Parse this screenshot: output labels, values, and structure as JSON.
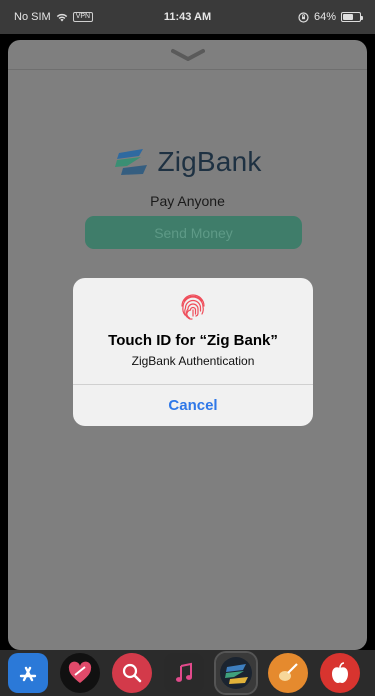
{
  "status_bar": {
    "carrier": "No SIM",
    "vpn": "VPN",
    "time": "11:43 AM",
    "battery_percent": "64%",
    "battery_level": 0.64
  },
  "app": {
    "brand_name": "ZigBank",
    "pay_anyone": "Pay Anyone",
    "send_money": "Send Money"
  },
  "alert": {
    "title": "Touch ID for “Zig Bank”",
    "subtitle": "ZigBank Authentication",
    "cancel": "Cancel"
  },
  "dock": {
    "icons": [
      "app-store-icon",
      "heart-app-icon",
      "search-app-icon",
      "music-icon",
      "zigbank-app-icon",
      "guitar-app-icon",
      "apple-app-icon"
    ]
  },
  "colors": {
    "accent": "#2f78e8",
    "send_button": "#3f7d6a",
    "brand_text": "#1e3142"
  }
}
